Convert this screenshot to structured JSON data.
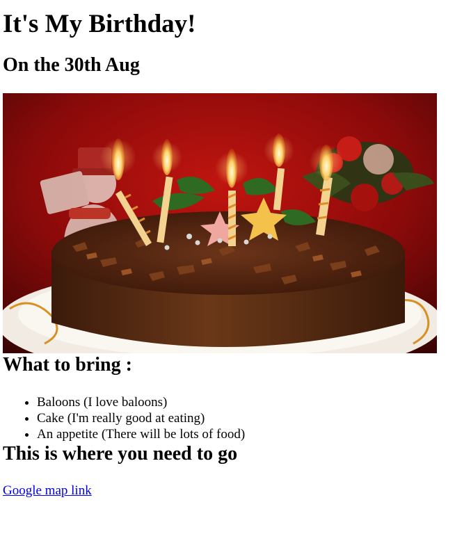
{
  "heading": "It's My Birthday!",
  "date": "On the 30th Aug",
  "image": {
    "alt": "Chocolate birthday cake with lit candles",
    "colors": {
      "background": "#8b0a0a",
      "cake": "#5a2e17",
      "flame": "#ffd36b"
    }
  },
  "bring": {
    "title": "What to bring :",
    "items": [
      "Baloons (I love baloons)",
      "Cake (I'm really good at eating)",
      "An appetite (There will be lots of food)"
    ]
  },
  "directions": {
    "title": "This is where you need to go",
    "link_text": "Google map link"
  }
}
